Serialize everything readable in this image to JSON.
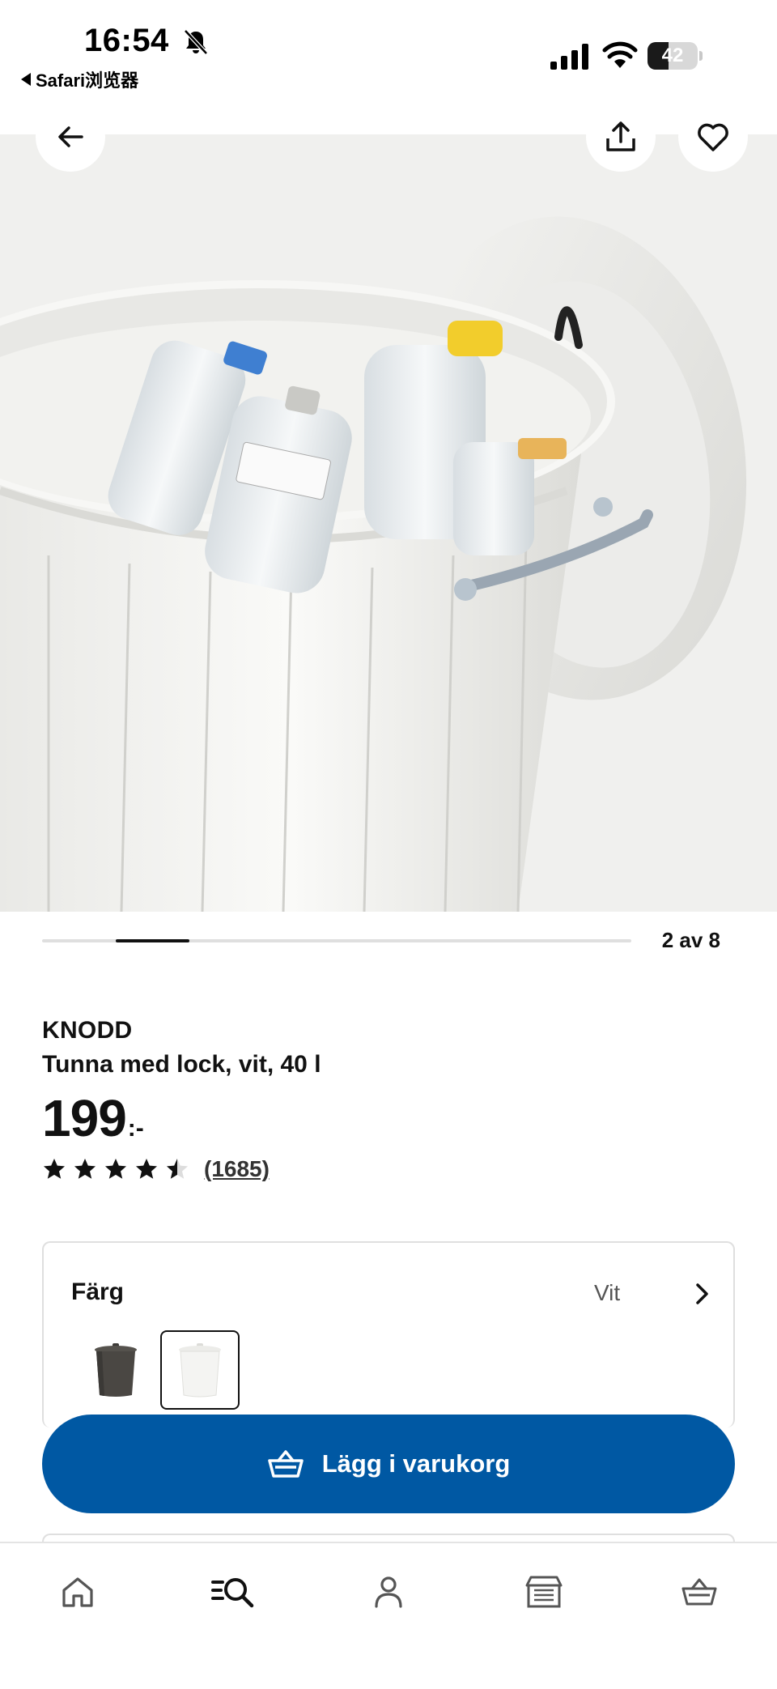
{
  "status_bar": {
    "time": "16:54",
    "back_app": "Safari浏览器",
    "battery_level": "42",
    "icons": [
      "bell-off-icon",
      "signal-icon",
      "wifi-icon",
      "battery-icon"
    ]
  },
  "header_buttons": {
    "icons": [
      "arrow-left-icon",
      "share-icon",
      "heart-icon"
    ]
  },
  "carousel": {
    "counter": "2 av 8",
    "current": 2,
    "total": 8
  },
  "product": {
    "brand": "KNODD",
    "description": "Tunna med lock, vit, 40 l",
    "price_integer": "199",
    "price_suffix": ":-",
    "rating": 4.5,
    "rating_max": 5,
    "review_count": "(1685)"
  },
  "color_selector": {
    "label": "Färg",
    "selected_value": "Vit",
    "options": [
      "dark-grey",
      "white"
    ],
    "selected_index": 1
  },
  "cart": {
    "button_label": "Lägg i varukorg",
    "accent_color": "#0058a3"
  },
  "bottom_nav": {
    "items": [
      "home-icon",
      "search-icon",
      "profile-icon",
      "store-icon",
      "cart-icon"
    ],
    "active_index": 1
  }
}
